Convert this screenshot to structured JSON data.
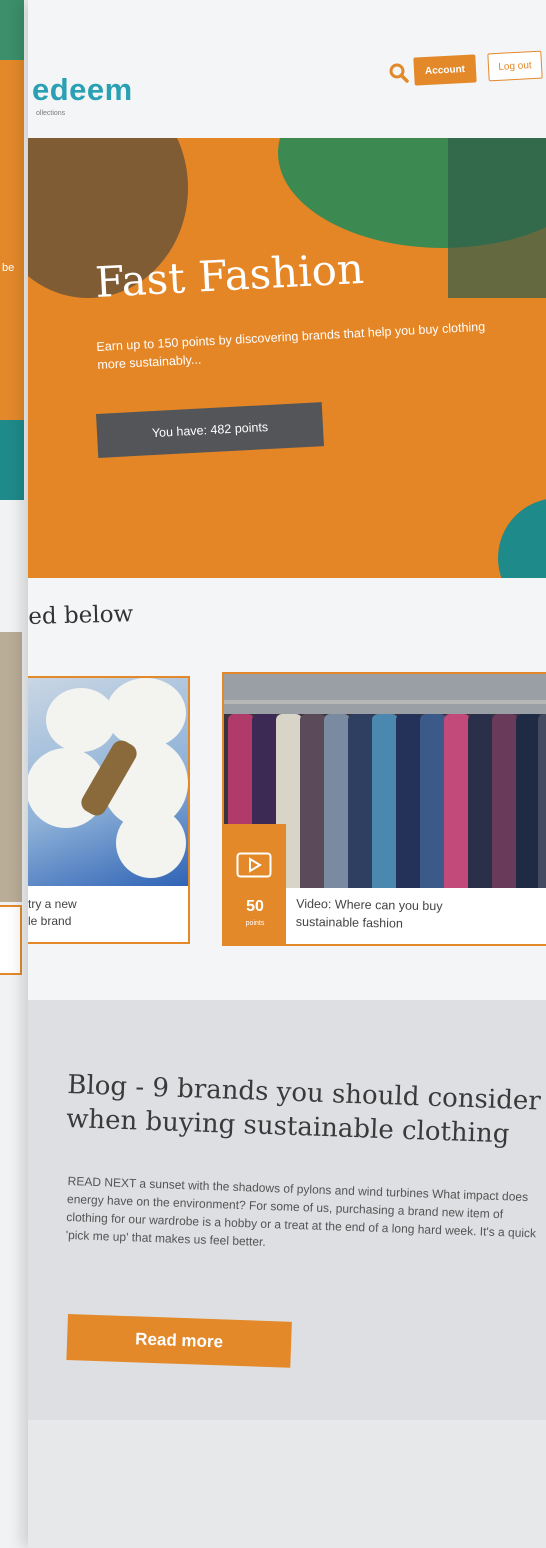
{
  "header": {
    "logo_text": "edeem",
    "logo_sub": "ollections",
    "account_label": "Account",
    "logout_label": "Log out"
  },
  "hero": {
    "title": "Fast Fashion",
    "description": "Earn up to 150 points by discovering brands that help you buy clothing more sustainably...",
    "points_label": "You have: 482 points",
    "accent_color": "#e3892a"
  },
  "section": {
    "title": "ed below"
  },
  "cards": [
    {
      "label_line1": "try a new",
      "label_line2": "le brand"
    },
    {
      "badge_points": "50",
      "badge_unit": "points",
      "label_line1": "Video: Where can you buy",
      "label_line2": "sustainable fashion",
      "icon": "play-icon"
    }
  ],
  "blog": {
    "title": "Blog - 9 brands you should consider when buying sustainable clothing",
    "body": "READ NEXT a sunset with the shadows of pylons and wind turbines What impact does energy have on the environment? For some of us, purchasing a brand new item of clothing for our wardrobe is a hobby or a treat at the end of a long hard week. It's a quick 'pick me up' that makes us feel better.",
    "button_label": "Read more"
  },
  "back_page": {
    "fragment": "be"
  }
}
